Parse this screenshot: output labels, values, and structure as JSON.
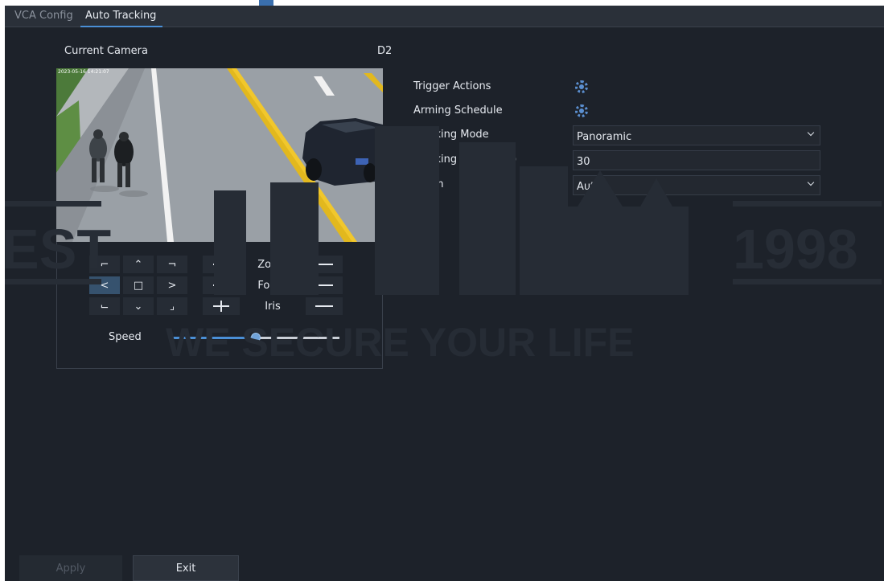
{
  "tabs": [
    {
      "label": "VCA Config",
      "active": false
    },
    {
      "label": "Auto Tracking",
      "active": true
    }
  ],
  "camera": {
    "label": "Current Camera",
    "value": "D2"
  },
  "video": {
    "osd_text": "2023-05-16 14:21:07"
  },
  "ptz": {
    "directions": {
      "up_left": "⌐",
      "up": "⌃",
      "up_right": "¬",
      "left": "<",
      "center": "□",
      "right": ">",
      "down_left": "⌙",
      "down": "⌄",
      "down_right": "⌟"
    },
    "zoom_label": "Zoom",
    "focus_label": "Focus",
    "iris_label": "Iris",
    "speed_label": "Speed",
    "speed_value_percent": 50
  },
  "settings": {
    "trigger_actions": "Trigger Actions",
    "arming_schedule": "Arming Schedule",
    "tracking_mode": {
      "label": "Tracking Mode",
      "value": "Panoramic"
    },
    "tracking_timeout": {
      "label": "Tracking Timeout(s)",
      "value": "30"
    },
    "zoom": {
      "label": "Zoom",
      "value": "Auto"
    }
  },
  "footer": {
    "apply_label": "Apply",
    "exit_label": "Exit"
  },
  "watermark": {
    "left_text": "EST",
    "right_text": "1998",
    "tagline": "WE SECURE YOUR LIFE"
  },
  "colors": {
    "accent": "#4a8fd6",
    "background": "#1d222a",
    "selected": "#36526e"
  }
}
